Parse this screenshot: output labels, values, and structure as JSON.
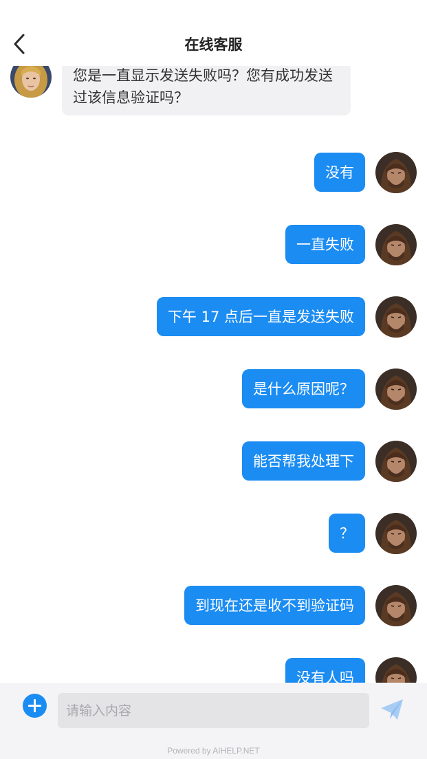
{
  "header": {
    "title": "在线客服",
    "back_icon": "chevron-left-icon"
  },
  "messages": [
    {
      "from": "agent",
      "text": "您是一直显示发送失败吗？您有成功发送过该信息验证吗？"
    },
    {
      "from": "user",
      "text": "没有"
    },
    {
      "from": "user",
      "text": "一直失败"
    },
    {
      "from": "user",
      "text": "下午 17 点后一直是发送失败"
    },
    {
      "from": "user",
      "text": "是什么原因呢？"
    },
    {
      "from": "user",
      "text": "能否帮我处理下"
    },
    {
      "from": "user",
      "text": "？"
    },
    {
      "from": "user",
      "text": "到现在还是收不到验证码"
    },
    {
      "from": "user",
      "text": "没有人吗"
    }
  ],
  "footer": {
    "add_icon": "plus-circle-icon",
    "input_placeholder": "请输入内容",
    "input_value": "",
    "send_icon": "paper-plane-icon",
    "powered_by": "Powered by AIHELP.NET"
  },
  "colors": {
    "accent": "#1b8cf2",
    "agent_bubble": "#f1f1f3",
    "footer_bg": "#f4f4f6"
  }
}
